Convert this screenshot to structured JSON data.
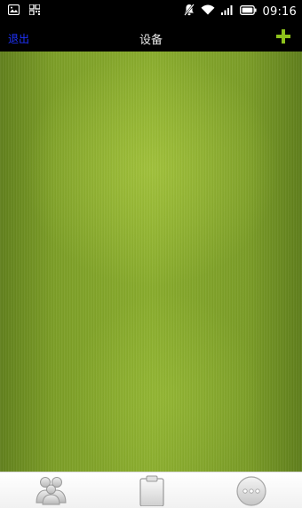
{
  "status_bar": {
    "time": "09:16",
    "icons": [
      "image-icon",
      "qr-icon",
      "mute-icon",
      "wifi-icon",
      "signal-icon",
      "battery-icon"
    ]
  },
  "nav": {
    "exit_label": "退出",
    "title": "设备",
    "add_icon": "plus-icon"
  },
  "tabs": [
    {
      "icon": "contacts-icon"
    },
    {
      "icon": "clipboard-icon"
    },
    {
      "icon": "more-icon"
    }
  ],
  "colors": {
    "exit": "#1f33ff",
    "add": "#8ec21c",
    "background": "#82a428"
  }
}
